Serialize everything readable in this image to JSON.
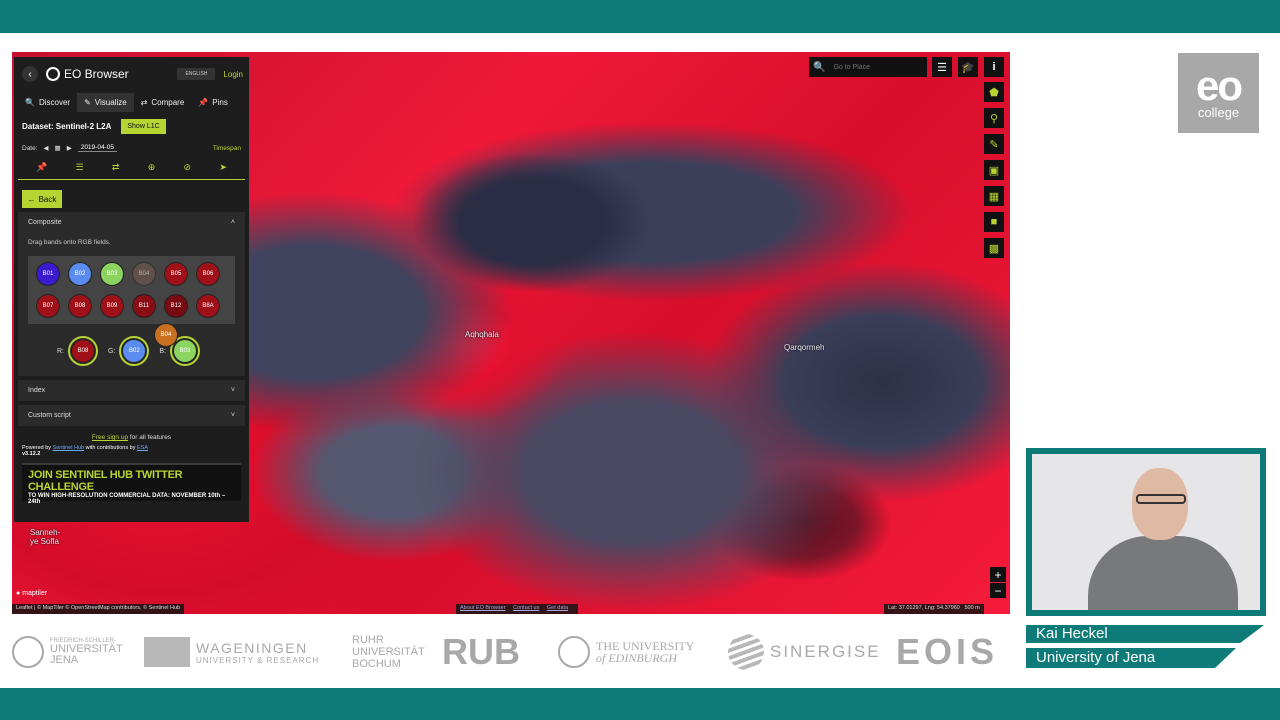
{
  "colors": {
    "teal": "#0f7b78",
    "accent": "#b6d432",
    "panel_bg": "#1d1d1d"
  },
  "map": {
    "search_placeholder": "Go to Place",
    "places": [
      "Aqhqhala",
      "Qarqormeh",
      "Sanneh-\nye Sofla"
    ],
    "attribution_left": "Leaflet | © MapTiler © OpenStreetMap contributors, © Sentinel Hub",
    "attribution_links": [
      "About EO Browser",
      "Contact us",
      "Get data"
    ],
    "coords": "Lat: 37.01297, Lng: 54.37960",
    "scale": "500 m",
    "maptiler": "maptiler",
    "zoom_in": "+",
    "zoom_out": "−",
    "tool_icons": [
      "layers-icon",
      "graduation-cap-icon",
      "info-icon",
      "pentagon-icon",
      "pin-icon",
      "ruler-icon",
      "image-download-icon",
      "film-icon",
      "cube-icon",
      "chart-icon"
    ]
  },
  "panel": {
    "app_title": "EO Browser",
    "language": "ENGLISH",
    "login": "Login",
    "tabs": [
      "Discover",
      "Visualize",
      "Compare",
      "Pins"
    ],
    "dataset_label": "Dataset: Sentinel-2 L2A",
    "show_button": "Show L1C",
    "date_label": "Date:",
    "date_value": "2019-04-05",
    "timespan": "Timespan",
    "back": "Back",
    "composite": "Composite",
    "hint": "Drag bands onto RGB fields.",
    "bands": [
      {
        "label": "B01",
        "color": "#3a1bd0"
      },
      {
        "label": "B02",
        "color": "#5a8cf0"
      },
      {
        "label": "B03",
        "color": "#8cd460"
      },
      {
        "label": "B04",
        "color": "#7a5a50"
      },
      {
        "label": "B05",
        "color": "#a01018"
      },
      {
        "label": "B06",
        "color": "#a01018"
      },
      {
        "label": "B07",
        "color": "#a01018"
      },
      {
        "label": "B08",
        "color": "#a01018"
      },
      {
        "label": "B09",
        "color": "#a01018"
      },
      {
        "label": "B11",
        "color": "#8a0c14"
      },
      {
        "label": "B12",
        "color": "#7a0a12"
      },
      {
        "label": "B8A",
        "color": "#a01018"
      }
    ],
    "dragging_band": "B04",
    "r_label": "R:",
    "g_label": "G:",
    "b_label": "B:",
    "r_band": "B08",
    "g_band": "B02",
    "b_band": "B03",
    "index": "Index",
    "custom_script": "Custom script",
    "signup_link": "Free sign up",
    "signup_rest": "for all features",
    "powered_prefix": "Powered by",
    "powered_link1": "Sentinel Hub",
    "powered_mid": "with contributions by",
    "powered_link2": "ESA",
    "version": "v3.12.2",
    "banner_line1": "JOIN SENTINEL HUB TWITTER CHALLENGE",
    "banner_line2": "TO WIN HIGH-RESOLUTION COMMERCIAL DATA: NOVEMBER 10th – 24th"
  },
  "overlay": {
    "logo_big": "eo",
    "logo_small": "college",
    "presenter_name": "Kai Heckel",
    "presenter_org": "University of Jena"
  },
  "partners": {
    "jena_1": "FRIEDRICH-SCHILLER-",
    "jena_2": "UNIVERSITÄT",
    "jena_3": "JENA",
    "wag_1": "WAGENINGEN",
    "wag_2": "UNIVERSITY & RESEARCH",
    "rub_1": "RUHR",
    "rub_2": "UNIVERSITÄT",
    "rub_3": "BOCHUM",
    "rub_big": "RUB",
    "edin_1": "THE UNIVERSITY",
    "edin_2": "of EDINBURGH",
    "sinergise": "SINERGISE",
    "eois": "EOIS"
  }
}
